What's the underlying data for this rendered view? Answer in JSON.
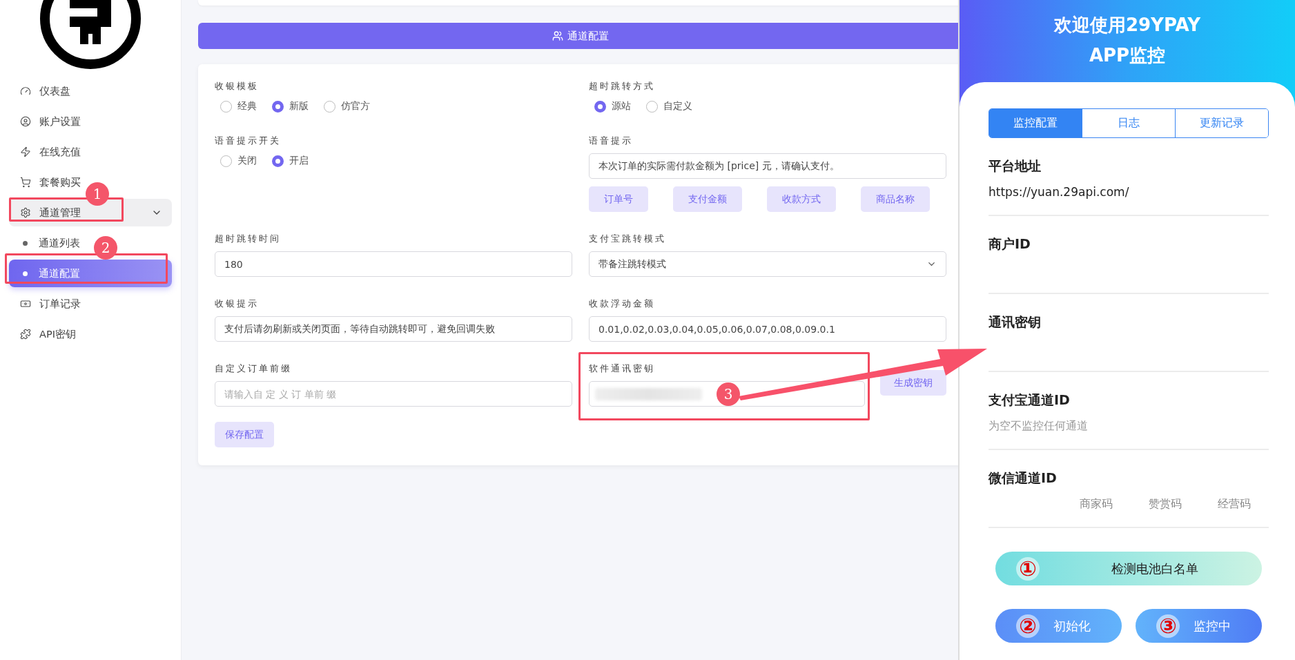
{
  "sidebar": {
    "items": [
      {
        "label": "仪表盘",
        "selected": false
      },
      {
        "label": "账户设置",
        "selected": false
      },
      {
        "label": "在线充值",
        "selected": false
      },
      {
        "label": "套餐购买",
        "selected": false
      },
      {
        "label": "通道管理",
        "selected": false,
        "expanded": true,
        "children": [
          {
            "label": "通道列表",
            "selected": false
          },
          {
            "label": "通道配置",
            "selected": true
          }
        ]
      },
      {
        "label": "订单记录",
        "selected": false
      },
      {
        "label": "API密钥",
        "selected": false
      }
    ]
  },
  "header_bar": {
    "title": "通道配置"
  },
  "form": {
    "fields": [
      {
        "kind": "radio",
        "label": "收银模板",
        "options": [
          {
            "label": "经典",
            "selected": false
          },
          {
            "label": "新版",
            "selected": true
          },
          {
            "label": "仿官方",
            "selected": false
          }
        ]
      },
      {
        "kind": "radio",
        "label": "超时跳转方式",
        "options": [
          {
            "label": "源站",
            "selected": true
          },
          {
            "label": "自定义",
            "selected": false
          }
        ]
      },
      {
        "kind": "radio",
        "label": "语音提示开关",
        "options": [
          {
            "label": "关闭",
            "selected": false
          },
          {
            "label": "开启",
            "selected": true
          }
        ]
      },
      {
        "kind": "input",
        "label": "语音提示",
        "value": "本次订单的实际需付款金额为 [price] 元，请确认支付。",
        "chips": [
          "订单号",
          "支付金额",
          "收款方式",
          "商品名称"
        ]
      },
      {
        "kind": "input",
        "label": "超时跳转时间",
        "value": "180"
      },
      {
        "kind": "select",
        "label": "支付宝跳转模式",
        "value": "带备注跳转模式"
      },
      {
        "kind": "input",
        "label": "收银提示",
        "value": "支付后请勿刷新或关闭页面，等待自动跳转即可，避免回调失败"
      },
      {
        "kind": "input",
        "label": "收款浮动金额",
        "value": "0.01,0.02,0.03,0.04,0.05,0.06,0.07,0.08,0.09.0.1"
      },
      {
        "kind": "input",
        "label": "自定义订单前缀",
        "placeholder": "请输入自 定 义 订 单前 缀"
      },
      {
        "kind": "secret",
        "label": "软件通讯密钥",
        "button": "生成密钥"
      }
    ],
    "save_button": "保存配置"
  },
  "annotations": [
    {
      "number": "1"
    },
    {
      "number": "2"
    },
    {
      "number": "3"
    }
  ],
  "phone": {
    "title_lines": [
      "欢迎使用29YPAY",
      "APP监控"
    ],
    "tabs": [
      {
        "label": "监控配置",
        "selected": true
      },
      {
        "label": "日志",
        "selected": false
      },
      {
        "label": "更新记录",
        "selected": false
      }
    ],
    "fields": [
      {
        "label": "平台地址",
        "value": "https://yuan.29api.com/"
      },
      {
        "label": "商户ID"
      },
      {
        "label": "通讯密钥"
      },
      {
        "label": "支付宝通道ID",
        "placeholder": "为空不监控任何通道"
      },
      {
        "label": "微信通道ID",
        "options": [
          "商家码",
          "赞赏码",
          "经营码"
        ]
      }
    ],
    "buttons": [
      {
        "kind": "wide",
        "mark": "①",
        "label": "检测电池白名单"
      },
      {
        "kind": "half",
        "mark": "②",
        "label": "初始化"
      },
      {
        "kind": "half",
        "mark": "③",
        "label": "监控中"
      }
    ]
  }
}
